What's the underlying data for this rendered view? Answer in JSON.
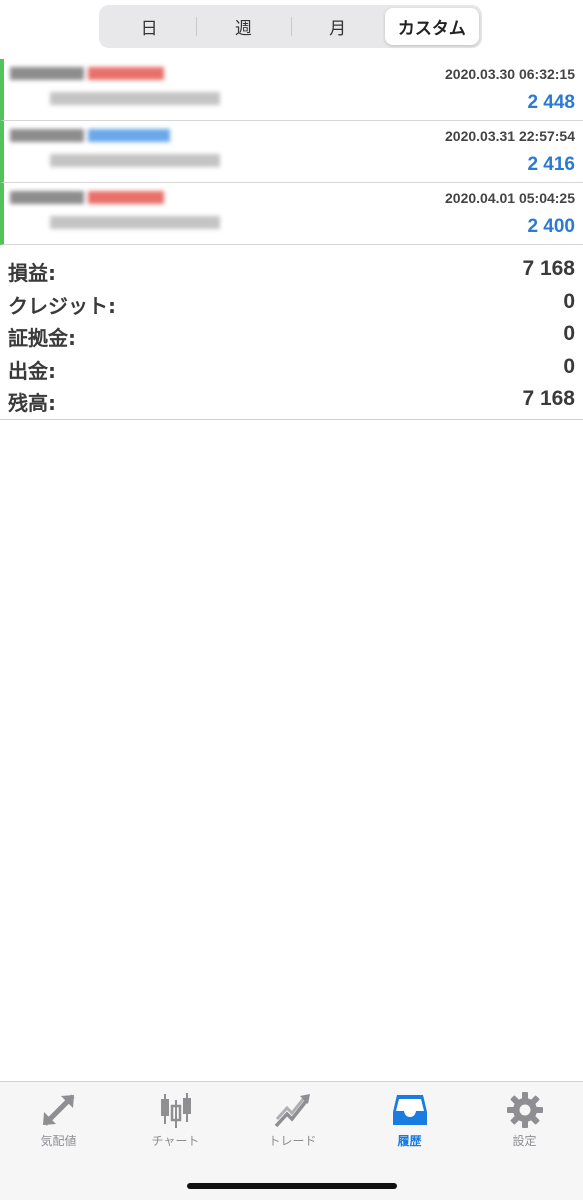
{
  "period_tabs": [
    {
      "label": "日",
      "active": false
    },
    {
      "label": "週",
      "active": false
    },
    {
      "label": "月",
      "active": false
    },
    {
      "label": "カスタム",
      "active": true
    }
  ],
  "deals": [
    {
      "datetime": "2020.03.30 06:32:15",
      "amount": "2 448",
      "accent": "#e8706a"
    },
    {
      "datetime": "2020.03.31 22:57:54",
      "amount": "2 416",
      "accent": "#6aa8ea"
    },
    {
      "datetime": "2020.04.01 05:04:25",
      "amount": "2 400",
      "accent": "#e8706a"
    }
  ],
  "summary": [
    {
      "label": "損益:",
      "value": "7 168"
    },
    {
      "label": "クレジット:",
      "value": "0"
    },
    {
      "label": "証拠金:",
      "value": "0"
    },
    {
      "label": "出金:",
      "value": "0"
    },
    {
      "label": "残高:",
      "value": "7 168"
    }
  ],
  "tabbar": [
    {
      "label": "気配値",
      "icon": "quotes-arrows-icon",
      "active": false
    },
    {
      "label": "チャート",
      "icon": "candlestick-chart-icon",
      "active": false
    },
    {
      "label": "トレード",
      "icon": "trade-trend-icon",
      "active": false
    },
    {
      "label": "履歴",
      "icon": "history-inbox-icon",
      "active": true
    },
    {
      "label": "設定",
      "icon": "settings-gear-icon",
      "active": false
    }
  ],
  "colors": {
    "accent_blue": "#2a7ad5",
    "active_tab_blue": "#1a7be0",
    "row_marker_green": "#52c35b"
  }
}
